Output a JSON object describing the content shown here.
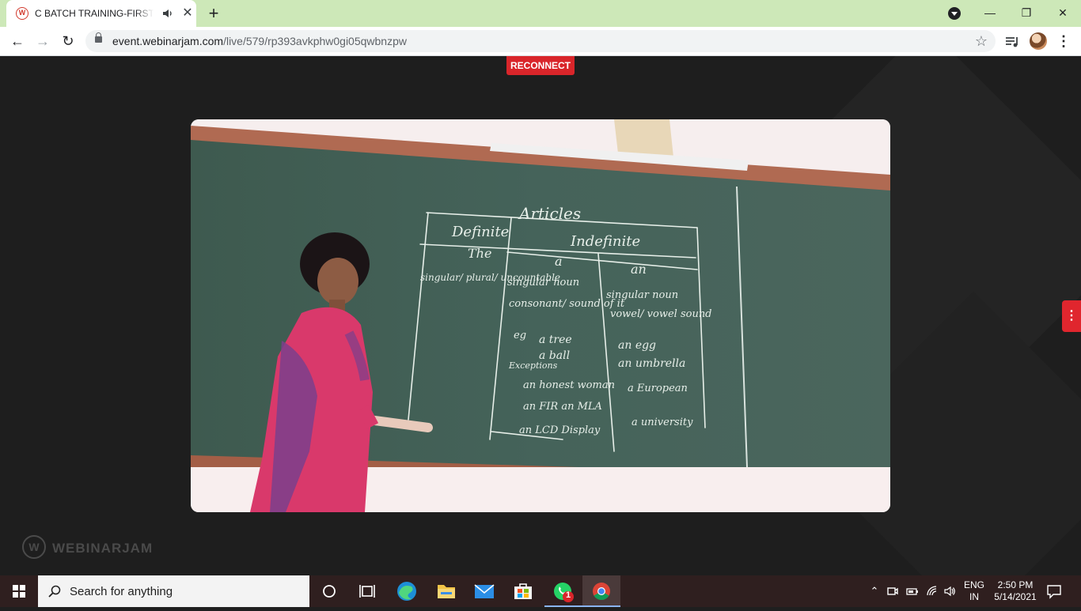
{
  "browser": {
    "tab": {
      "title": "C BATCH TRAINING-FIRST YEAR",
      "favicon": "webinarjam-icon",
      "audio": "speaker-icon"
    },
    "url": {
      "host": "event.webinarjam.com",
      "path": "/live/579/rp393avkphw0gi05qwbnzpw"
    }
  },
  "page": {
    "reconnect_label": "RECONNECT",
    "watermark_text": "WEBINARJAM",
    "watermark_logo": "W",
    "accent_color": "#d9252a",
    "board": {
      "heading": "Articles",
      "col_definite": "Definite",
      "col_indefinite": "Indefinite",
      "the": "The",
      "a": "a",
      "an": "an",
      "row1_left": "singular/ plural/ uncountable",
      "row1_mid": "singular noun",
      "row1_right": "singular noun",
      "row2_mid": "consonant/ sound of it",
      "row2_right": "vowel/ vowel sound",
      "eg": "eg",
      "ex_tree": "a tree",
      "ex_ball": "a ball",
      "ex_egg": "an egg",
      "ex_umbrella": "an umbrella",
      "exceptions": "Exceptions",
      "ex_honest": "an honest woman",
      "ex_european": "a European",
      "ex_fir": "an FIR an MLA",
      "ex_university": "a university",
      "ex_lcd": "an LCD Display"
    }
  },
  "taskbar": {
    "search_placeholder": "Search for anything",
    "whatsapp_badge": "1",
    "lang_line1": "ENG",
    "lang_line2": "IN",
    "time": "2:50 PM",
    "date": "5/14/2021"
  }
}
